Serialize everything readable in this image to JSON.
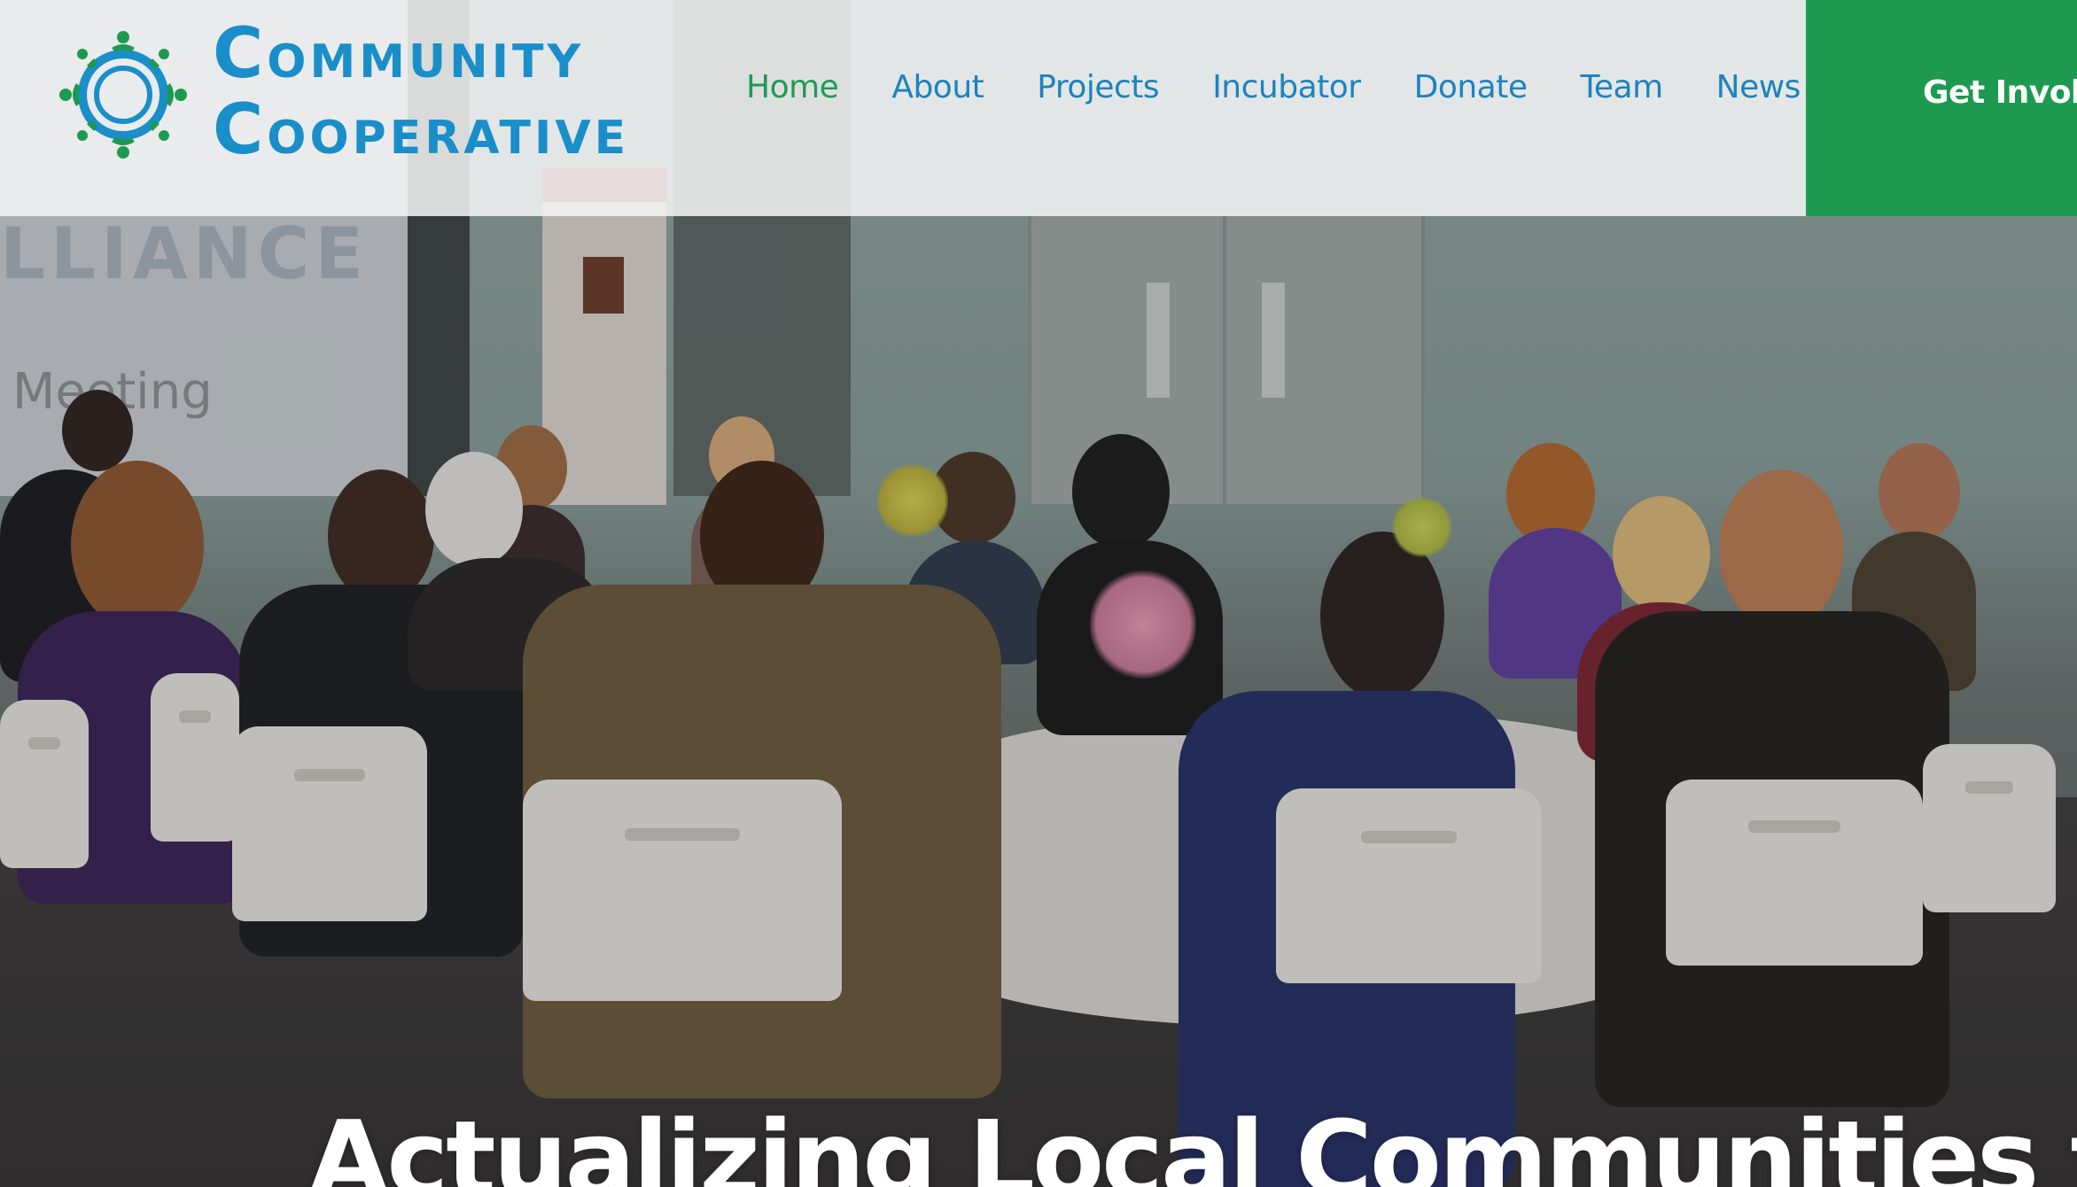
{
  "brand": {
    "line1": "Community",
    "line2": "Cooperative",
    "logo_icon": "community-circle-logo-icon",
    "primary_color": "#1a8ec9",
    "accent_color": "#1d9a50"
  },
  "nav": {
    "items": [
      {
        "label": "Home",
        "active": true
      },
      {
        "label": "About",
        "active": false
      },
      {
        "label": "Projects",
        "active": false
      },
      {
        "label": "Incubator",
        "active": false
      },
      {
        "label": "Donate",
        "active": false
      },
      {
        "label": "Team",
        "active": false
      },
      {
        "label": "News",
        "active": false
      }
    ],
    "active_color": "#1f9a55",
    "link_color": "#1d83bd"
  },
  "cta": {
    "label": "Get Involve"
  },
  "hero": {
    "headline": "Actualizing Local Communities to",
    "background_screen_text": "LLIANCE",
    "background_screen_sub": "Meeting"
  }
}
